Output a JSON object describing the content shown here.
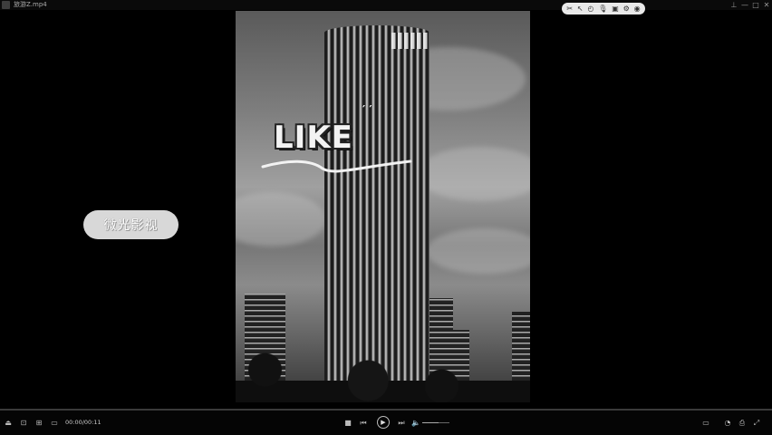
{
  "window": {
    "file_title": "旅游Z.mp4",
    "app_icon": "player-logo-icon",
    "controls": [
      {
        "name": "pin-icon",
        "glyph": "⊥"
      },
      {
        "name": "minimize-icon",
        "glyph": "—"
      },
      {
        "name": "maximize-icon",
        "glyph": "□"
      },
      {
        "name": "close-icon",
        "glyph": "✕"
      }
    ]
  },
  "capsule_toolbar": {
    "items": [
      {
        "name": "screen-capture-icon",
        "glyph": "✂"
      },
      {
        "name": "cursor-icon",
        "glyph": "↖"
      },
      {
        "name": "timer-icon",
        "glyph": "◴"
      },
      {
        "name": "microphone-icon",
        "glyph": "🎙"
      },
      {
        "name": "camera-icon",
        "glyph": "▣"
      },
      {
        "name": "settings-icon",
        "glyph": "⚙"
      },
      {
        "name": "stop-record-icon",
        "glyph": "◉"
      }
    ]
  },
  "video": {
    "overlay_text": "LIKE",
    "watermark_text": "微光影视"
  },
  "playback": {
    "time_display": "00:00/00:11",
    "progress": 0.0,
    "volume": 0.6
  },
  "controlbar": {
    "left": [
      {
        "name": "eject-icon",
        "glyph": "⏏"
      },
      {
        "name": "screen-icon",
        "glyph": "⊡"
      },
      {
        "name": "playlist-icon",
        "glyph": "⊞"
      },
      {
        "name": "subtitle-icon",
        "glyph": "▭"
      }
    ],
    "center": {
      "stop": "■",
      "prev": "⏮",
      "play": "▶",
      "next": "⏭",
      "volume": "🔈"
    },
    "right": [
      {
        "name": "display-mode-icon",
        "glyph": "▭"
      },
      {
        "name": "speed-icon",
        "glyph": "◔"
      },
      {
        "name": "share-icon",
        "glyph": "⎙"
      },
      {
        "name": "fullscreen-icon",
        "glyph": "⤢"
      }
    ]
  }
}
